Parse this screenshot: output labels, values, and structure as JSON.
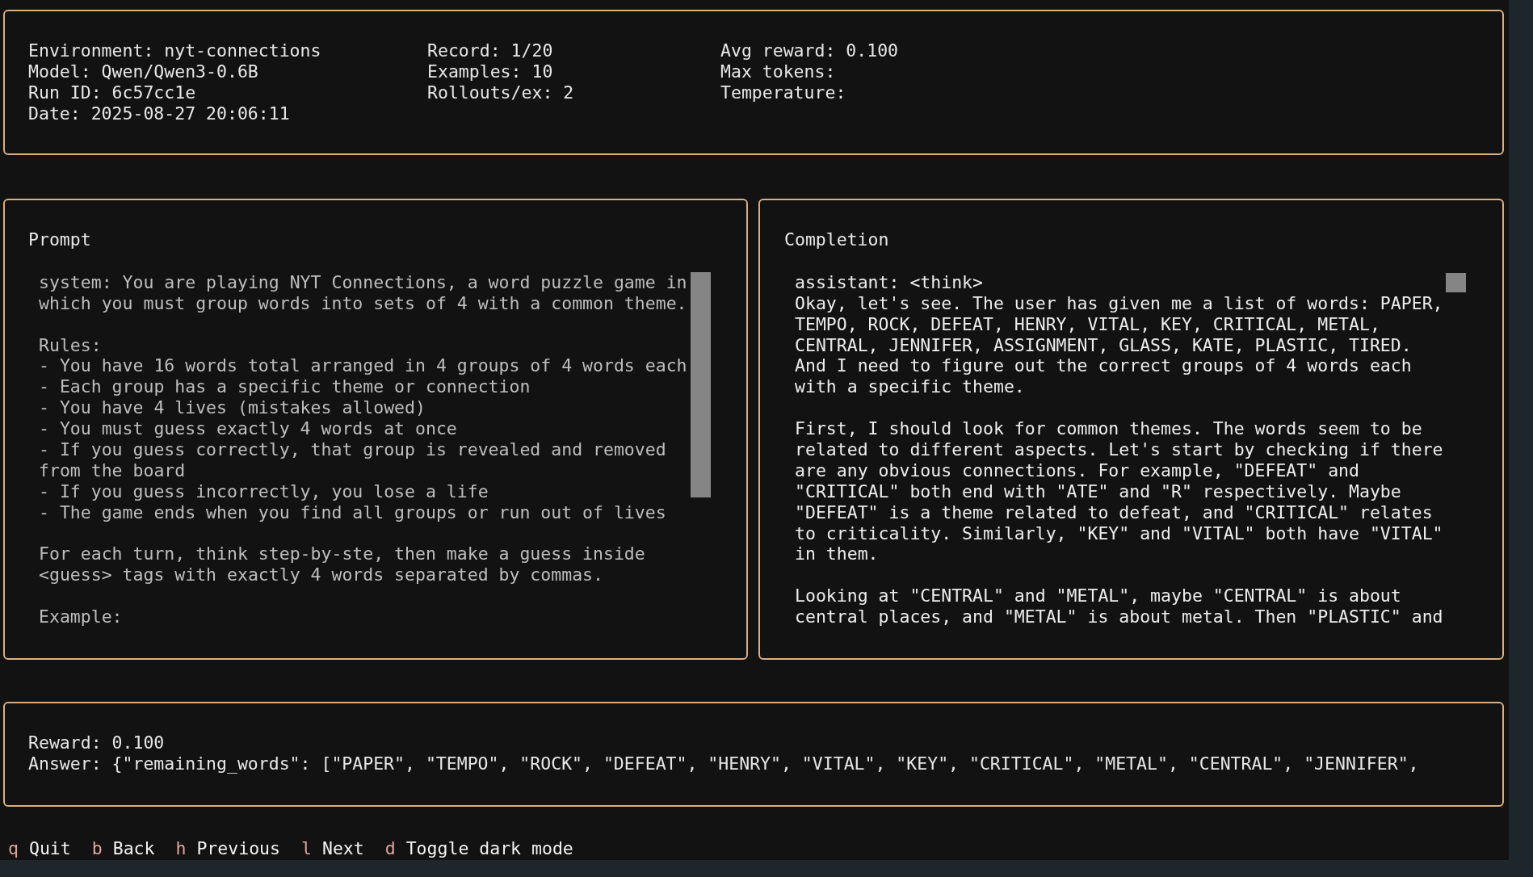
{
  "header": {
    "columns": [
      [
        "Environment: nyt-connections",
        "Model: Qwen/Qwen3-0.6B",
        "Run ID: 6c57cc1e",
        "Date: 2025-08-27 20:06:11"
      ],
      [
        "Record: 1/20",
        "Examples: 10",
        "Rollouts/ex: 2"
      ],
      [
        "Avg reward: 0.100",
        "Max tokens:",
        "Temperature:"
      ]
    ]
  },
  "prompt": {
    "title": "Prompt",
    "paragraphs": [
      [
        "system: You are playing NYT Connections, a word puzzle game in",
        "which you must group words into sets of 4 with a common theme."
      ],
      [
        "Rules:",
        "- You have 16 words total arranged in 4 groups of 4 words each",
        "- Each group has a specific theme or connection",
        "- You have 4 lives (mistakes allowed)",
        "- You must guess exactly 4 words at once",
        "- If you guess correctly, that group is revealed and removed",
        "from the board",
        "- If you guess incorrectly, you lose a life",
        "- The game ends when you find all groups or run out of lives"
      ],
      [
        "For each turn, think step-by-ste, then make a guess inside",
        "<guess> tags with exactly 4 words separated by commas."
      ],
      [
        "Example:"
      ]
    ]
  },
  "completion": {
    "title": "Completion",
    "paragraphs": [
      [
        "assistant: <think>",
        "Okay, let's see. The user has given me a list of words: PAPER,",
        "TEMPO, ROCK, DEFEAT, HENRY, VITAL, KEY, CRITICAL, METAL,",
        "CENTRAL, JENNIFER, ASSIGNMENT, GLASS, KATE, PLASTIC, TIRED.",
        "And I need to figure out the correct groups of 4 words each",
        "with a specific theme."
      ],
      [
        "First, I should look for common themes. The words seem to be",
        "related to different aspects. Let's start by checking if there",
        "are any obvious connections. For example, \"DEFEAT\" and",
        "\"CRITICAL\" both end with \"ATE\" and \"R\" respectively. Maybe",
        "\"DEFEAT\" is a theme related to defeat, and \"CRITICAL\" relates",
        "to criticality. Similarly, \"KEY\" and \"VITAL\" both have \"VITAL\"",
        "in them."
      ],
      [
        "Looking at \"CENTRAL\" and \"METAL\", maybe \"CENTRAL\" is about",
        "central places, and \"METAL\" is about metal. Then \"PLASTIC\" and"
      ]
    ]
  },
  "result": {
    "lines": [
      "Reward: 0.100",
      "Answer: {\"remaining_words\": [\"PAPER\", \"TEMPO\", \"ROCK\", \"DEFEAT\", \"HENRY\", \"VITAL\", \"KEY\", \"CRITICAL\", \"METAL\", \"CENTRAL\", \"JENNIFER\","
    ]
  },
  "footer": {
    "bindings": [
      {
        "key": "q",
        "label": "Quit"
      },
      {
        "key": "b",
        "label": "Back"
      },
      {
        "key": "h",
        "label": "Previous"
      },
      {
        "key": "l",
        "label": "Next"
      },
      {
        "key": "d",
        "label": "Toggle dark mode"
      }
    ]
  }
}
